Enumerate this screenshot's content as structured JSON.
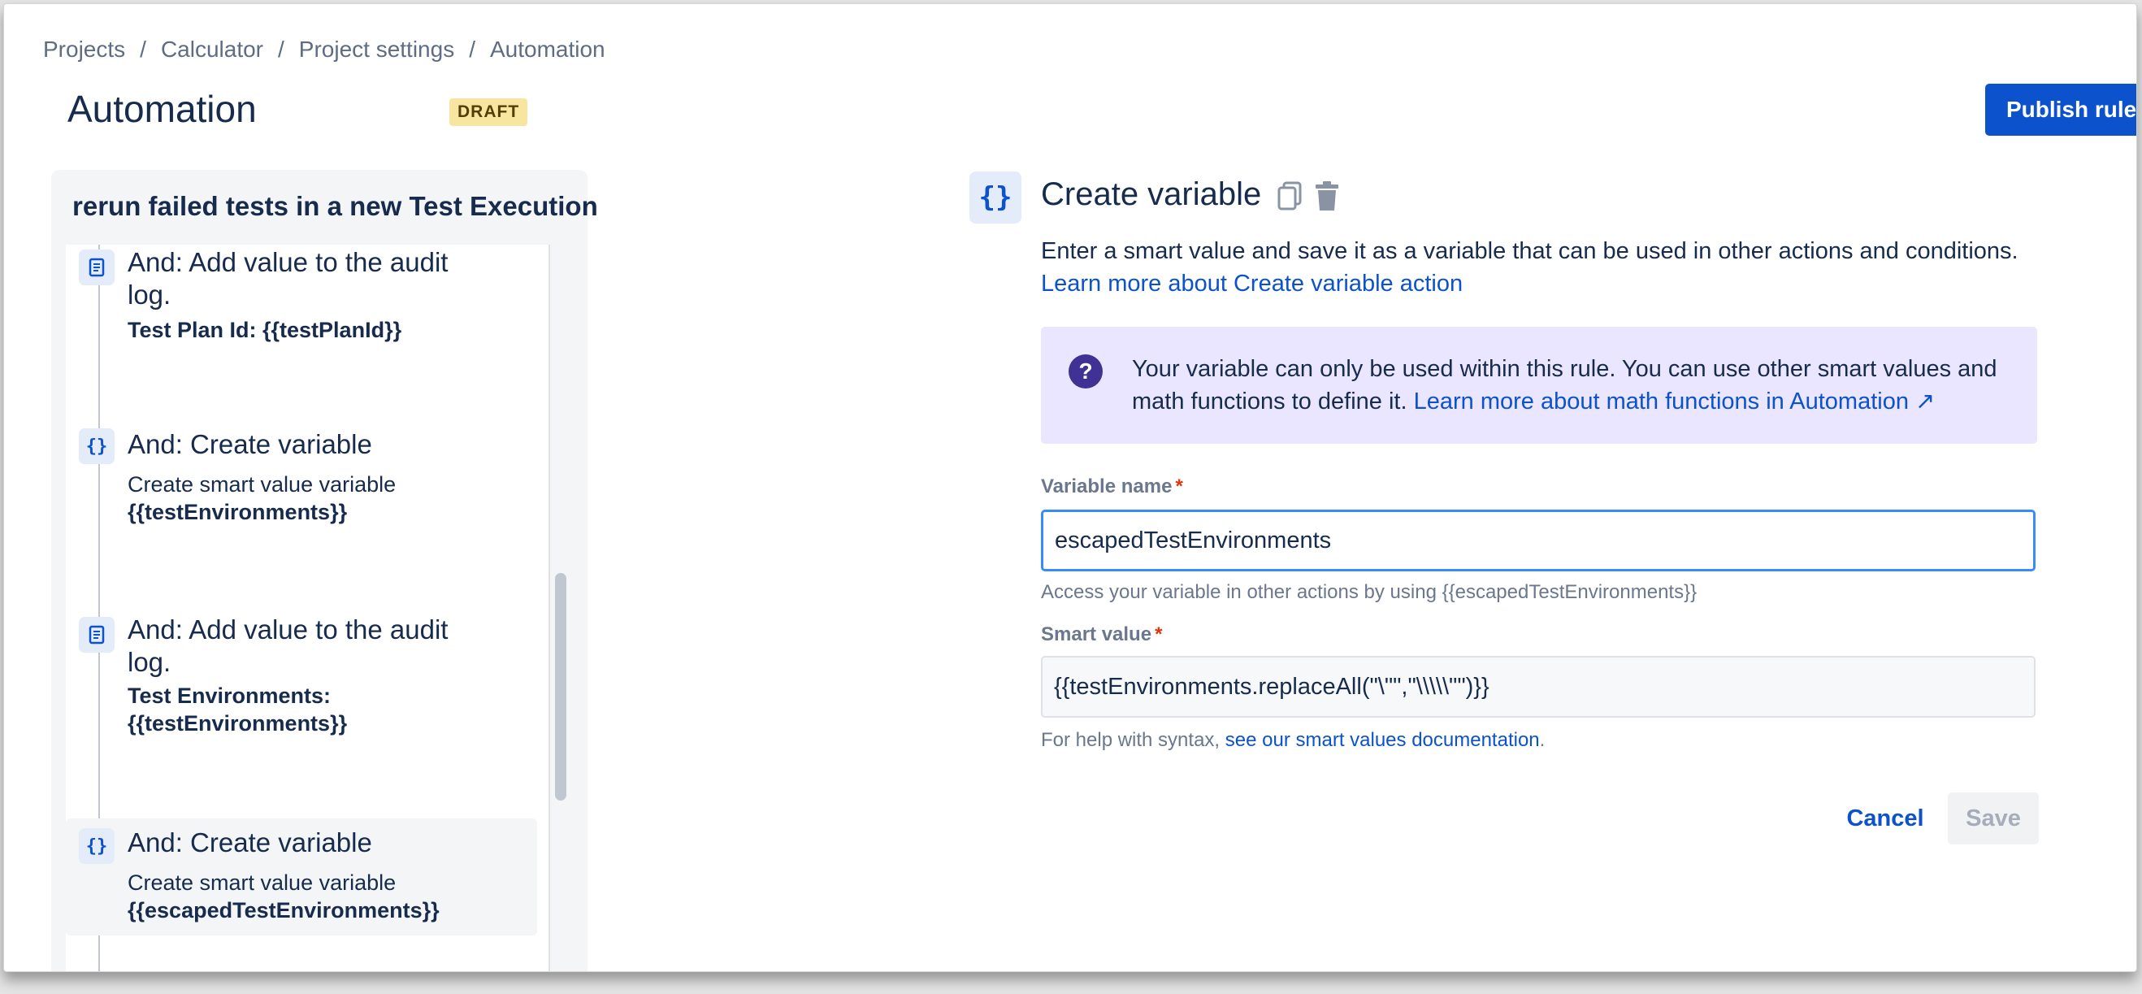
{
  "breadcrumb": [
    "Projects",
    "Calculator",
    "Project settings",
    "Automation"
  ],
  "breadcrumb_separator": "/",
  "header": {
    "title": "Automation",
    "badge": "DRAFT",
    "publish_label": "Publish rule"
  },
  "rule": {
    "name": "rerun failed tests in a new Test Execution",
    "items": [
      {
        "icon": "audit-log-icon",
        "title": "And: Add value to the audit log.",
        "sub_plain": "",
        "sub_bold": "Test Plan Id: {{testPlanId}}"
      },
      {
        "icon": "variable-icon",
        "title": "And: Create variable",
        "sub_plain": "Create smart value variable",
        "sub_bold": "{{testEnvironments}}"
      },
      {
        "icon": "audit-log-icon",
        "title": "And: Add value to the audit log.",
        "sub_plain": "",
        "sub_bold": "Test Environments: {{testEnvironments}}"
      },
      {
        "icon": "variable-icon",
        "title": "And: Create variable",
        "sub_plain": "Create smart value variable",
        "sub_bold": "{{escapedTestEnvironments}}",
        "selected": true
      }
    ]
  },
  "detail": {
    "icon_glyph": "{}",
    "title": "Create variable",
    "description": "Enter a smart value and save it as a variable that can be used in other actions and conditions.",
    "learn_more": "Learn more about Create variable action",
    "info_text": "Your variable can only be used within this rule. You can use other smart values and math functions to define it.",
    "info_link": "Learn more about math functions in Automation ↗",
    "variable_name_label": "Variable name",
    "variable_name_value": "escapedTestEnvironments",
    "variable_helper": "Access your variable in other actions by using {{escapedTestEnvironments}}",
    "smart_value_label": "Smart value",
    "smart_value_value": "{{testEnvironments.replaceAll(\"\\\"\",\"\\\\\\\\\\\"\")}}",
    "syntax_help_prefix": "For help with syntax,",
    "syntax_help_link": "see our smart values documentation",
    "syntax_help_suffix": ".",
    "required_marker": "*",
    "cancel_label": "Cancel",
    "save_label": "Save"
  },
  "colors": {
    "primary": "#0c52cc",
    "info_bg": "#eae6ff",
    "draft_bg": "#f8e6a0",
    "required": "#de350b"
  }
}
